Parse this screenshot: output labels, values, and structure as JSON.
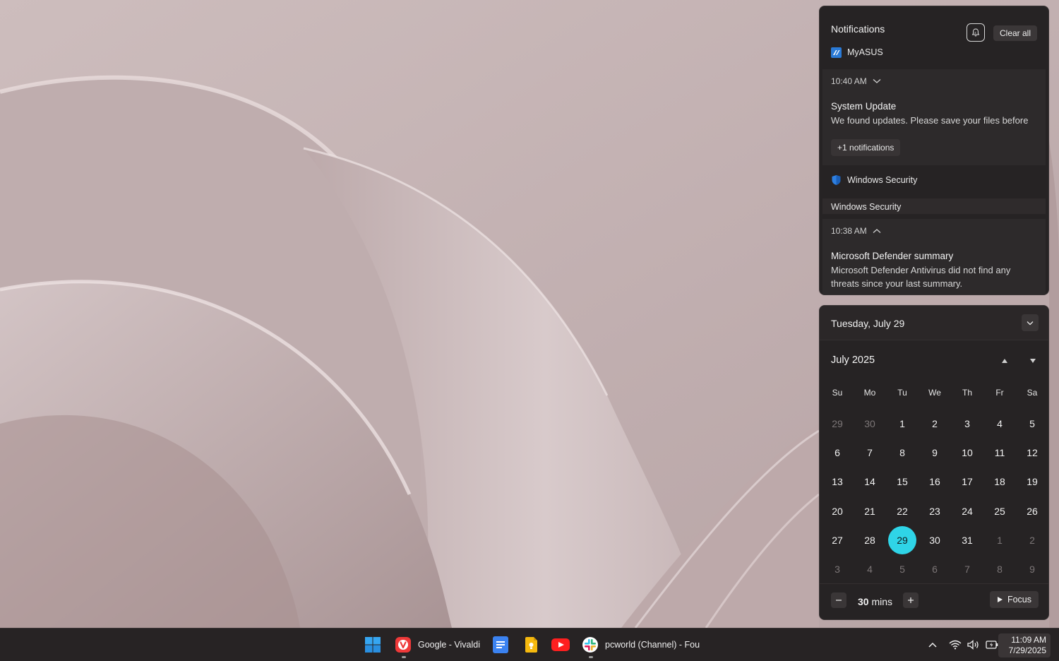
{
  "notifications": {
    "title": "Notifications",
    "clear_all": "Clear all",
    "groups": [
      {
        "app": "MyASUS",
        "time": "10:40 AM",
        "heading": "System Update",
        "body": "We found updates. Please save your files before",
        "more": "+1 notifications"
      },
      {
        "app": "Windows Security",
        "group_label": "Windows Security",
        "time": "10:38 AM",
        "heading": "Microsoft Defender summary",
        "body": "Microsoft Defender Antivirus did not find any threats since your last summary."
      }
    ]
  },
  "calendar": {
    "date_title": "Tuesday, July 29",
    "month_title": "July 2025",
    "weekdays": [
      "Su",
      "Mo",
      "Tu",
      "We",
      "Th",
      "Fr",
      "Sa"
    ],
    "days": [
      {
        "d": "29",
        "other": true
      },
      {
        "d": "30",
        "other": true
      },
      {
        "d": "1"
      },
      {
        "d": "2"
      },
      {
        "d": "3"
      },
      {
        "d": "4"
      },
      {
        "d": "5"
      },
      {
        "d": "6"
      },
      {
        "d": "7"
      },
      {
        "d": "8"
      },
      {
        "d": "9"
      },
      {
        "d": "10"
      },
      {
        "d": "11"
      },
      {
        "d": "12"
      },
      {
        "d": "13"
      },
      {
        "d": "14"
      },
      {
        "d": "15"
      },
      {
        "d": "16"
      },
      {
        "d": "17"
      },
      {
        "d": "18"
      },
      {
        "d": "19"
      },
      {
        "d": "20"
      },
      {
        "d": "21"
      },
      {
        "d": "22"
      },
      {
        "d": "23"
      },
      {
        "d": "24"
      },
      {
        "d": "25"
      },
      {
        "d": "26"
      },
      {
        "d": "27"
      },
      {
        "d": "28"
      },
      {
        "d": "29",
        "today": true
      },
      {
        "d": "30"
      },
      {
        "d": "31"
      },
      {
        "d": "1",
        "other": true
      },
      {
        "d": "2",
        "other": true
      },
      {
        "d": "3",
        "other": true
      },
      {
        "d": "4",
        "other": true
      },
      {
        "d": "5",
        "other": true
      },
      {
        "d": "6",
        "other": true
      },
      {
        "d": "7",
        "other": true
      },
      {
        "d": "8",
        "other": true
      },
      {
        "d": "9",
        "other": true
      }
    ],
    "focus": {
      "value": "30",
      "unit": "mins",
      "button": "Focus"
    },
    "accent_color": "#2fd4e7"
  },
  "taskbar": {
    "apps": [
      {
        "icon": "windows-start-icon"
      },
      {
        "icon": "vivaldi-icon",
        "label": "Google - Vivaldi"
      },
      {
        "icon": "google-docs-icon"
      },
      {
        "icon": "google-keep-icon"
      },
      {
        "icon": "youtube-icon"
      },
      {
        "icon": "slack-icon",
        "label": "pcworld (Channel) - Fou"
      }
    ],
    "clock": {
      "time": "11:09 AM",
      "date": "7/29/2025"
    }
  }
}
